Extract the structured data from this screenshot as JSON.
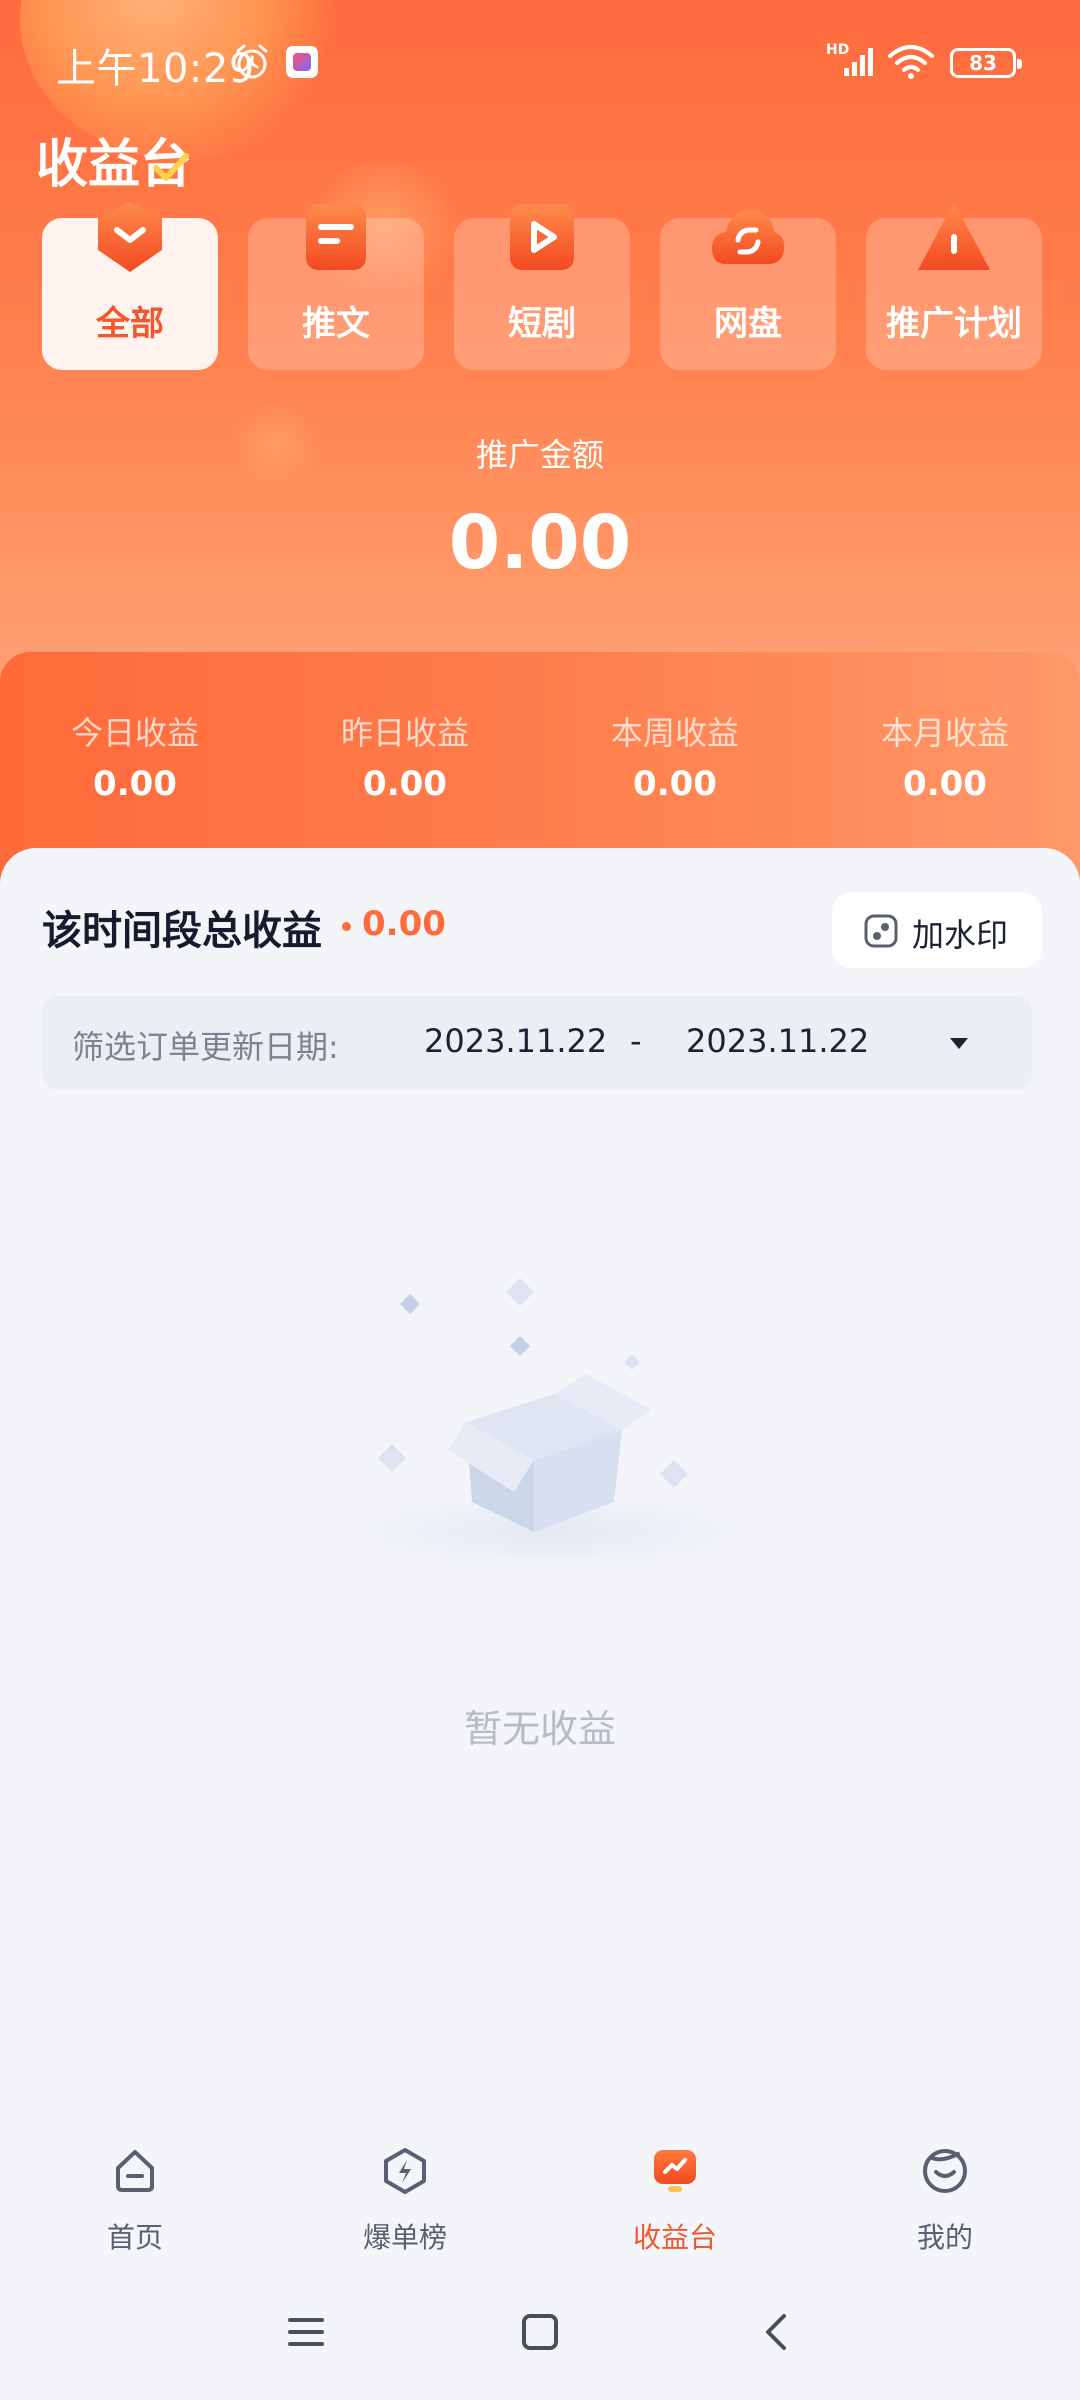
{
  "status_bar": {
    "time": "上午10:29",
    "network": "HD",
    "battery": "83"
  },
  "page": {
    "title": "收益台"
  },
  "categories": [
    {
      "label": "全部",
      "icon": "shield-chevron-icon",
      "active": true
    },
    {
      "label": "推文",
      "icon": "document-icon",
      "active": false
    },
    {
      "label": "短剧",
      "icon": "play-icon",
      "active": false
    },
    {
      "label": "网盘",
      "icon": "cloud-sync-icon",
      "active": false
    },
    {
      "label": "推广计划",
      "icon": "warning-triangle-icon",
      "active": false
    }
  ],
  "promo": {
    "label": "推广金额",
    "value": "0.00"
  },
  "stats": [
    {
      "label": "今日收益",
      "value": "0.00"
    },
    {
      "label": "昨日收益",
      "value": "0.00"
    },
    {
      "label": "本周收益",
      "value": "0.00"
    },
    {
      "label": "本月收益",
      "value": "0.00"
    }
  ],
  "summary": {
    "title": "该时间段总收益",
    "value": "0.00",
    "watermark_label": "加水印"
  },
  "filter": {
    "label": "筛选订单更新日期:",
    "start_date": "2023.11.22",
    "separator": "-",
    "end_date": "2023.11.22"
  },
  "empty_state": {
    "text": "暂无收益"
  },
  "tabbar": [
    {
      "label": "首页",
      "icon": "home-icon",
      "active": false
    },
    {
      "label": "爆单榜",
      "icon": "lightning-icon",
      "active": false
    },
    {
      "label": "收益台",
      "icon": "chart-icon",
      "active": true
    },
    {
      "label": "我的",
      "icon": "face-icon",
      "active": false
    }
  ],
  "colors": {
    "accent": "#ff6b3d",
    "active_text": "#f2572d",
    "panel_bg": "#f3f5f9"
  }
}
